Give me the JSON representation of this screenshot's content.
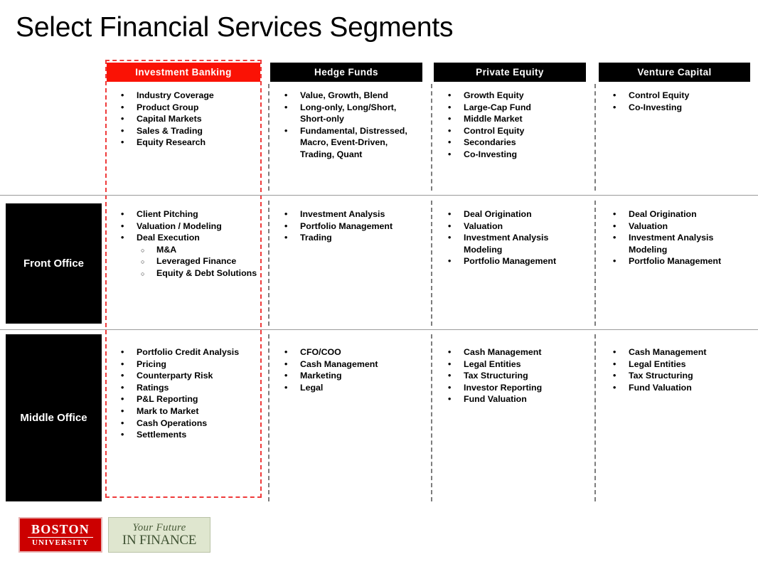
{
  "slide": {
    "title": "Select Financial Services Segments",
    "accent_color": "#fa1205",
    "header_color": "#000000",
    "highlight_border_color": "#ef3b3b",
    "divider_color": "#7d7d7d"
  },
  "columns": [
    {
      "id": "investment-banking",
      "label": "Investment  Banking",
      "highlighted": true
    },
    {
      "id": "hedge-funds",
      "label": "Hedge  Funds",
      "highlighted": false
    },
    {
      "id": "private-equity",
      "label": "Private Equity",
      "highlighted": false
    },
    {
      "id": "venture-capital",
      "label": "Venture  Capital",
      "highlighted": false
    }
  ],
  "rows": [
    {
      "id": "segment-types",
      "label": ""
    },
    {
      "id": "front-office",
      "label": "Front Office"
    },
    {
      "id": "middle-office",
      "label": "Middle Office"
    }
  ],
  "cells": {
    "segment_types": {
      "investment_banking": [
        {
          "text": "Industry Coverage"
        },
        {
          "text": "Product Group"
        },
        {
          "text": "Capital Markets"
        },
        {
          "text": "Sales & Trading"
        },
        {
          "text": "Equity Research"
        }
      ],
      "hedge_funds": [
        {
          "text": "Value, Growth, Blend"
        },
        {
          "text": "Long-only, Long/Short, Short-only"
        },
        {
          "text": "Fundamental, Distressed, Macro, Event-Driven, Trading, Quant"
        }
      ],
      "private_equity": [
        {
          "text": "Growth Equity"
        },
        {
          "text": "Large-Cap Fund"
        },
        {
          "text": "Middle Market"
        },
        {
          "text": "Control Equity"
        },
        {
          "text": "Secondaries"
        },
        {
          "text": "Co-Investing"
        }
      ],
      "venture_capital": [
        {
          "text": "Control Equity"
        },
        {
          "text": "Co-Investing"
        }
      ]
    },
    "front_office": {
      "investment_banking": [
        {
          "text": "Client Pitching"
        },
        {
          "text": "Valuation / Modeling"
        },
        {
          "text": "Deal Execution"
        },
        {
          "text": "M&A",
          "sub": true
        },
        {
          "text": "Leveraged Finance",
          "sub": true
        },
        {
          "text": "Equity & Debt Solutions",
          "sub": true
        }
      ],
      "hedge_funds": [
        {
          "text": "Investment Analysis"
        },
        {
          "text": "Portfolio Management"
        },
        {
          "text": "Trading"
        }
      ],
      "private_equity": [
        {
          "text": "Deal Origination"
        },
        {
          "text": "Valuation"
        },
        {
          "text": "Investment Analysis Modeling"
        },
        {
          "text": "Portfolio Management"
        }
      ],
      "venture_capital": [
        {
          "text": "Deal Origination"
        },
        {
          "text": "Valuation"
        },
        {
          "text": "Investment Analysis Modeling"
        },
        {
          "text": "Portfolio Management"
        }
      ]
    },
    "middle_office": {
      "investment_banking": [
        {
          "text": "Portfolio Credit Analysis"
        },
        {
          "text": "Pricing"
        },
        {
          "text": "Counterparty Risk"
        },
        {
          "text": "Ratings"
        },
        {
          "text": "P&L Reporting"
        },
        {
          "text": "Mark to Market"
        },
        {
          "text": "Cash Operations"
        },
        {
          "text": "Settlements"
        }
      ],
      "hedge_funds": [
        {
          "text": "CFO/COO"
        },
        {
          "text": "Cash Management"
        },
        {
          "text": "Marketing"
        },
        {
          "text": "Legal"
        }
      ],
      "private_equity": [
        {
          "text": "Cash Management"
        },
        {
          "text": "Legal Entities"
        },
        {
          "text": "Tax Structuring"
        },
        {
          "text": "Investor Reporting"
        },
        {
          "text": "Fund Valuation"
        }
      ],
      "venture_capital": [
        {
          "text": "Cash Management"
        },
        {
          "text": "Legal Entities"
        },
        {
          "text": "Tax Structuring"
        },
        {
          "text": "Fund Valuation"
        }
      ]
    }
  },
  "footer": {
    "bu_logo": {
      "line1": "BOSTON",
      "line2": "UNIVERSITY",
      "color": "#cc0000"
    },
    "yf_logo": {
      "line1": "Your Future",
      "line2": "IN FINANCE",
      "color": "#dfe6cf"
    }
  },
  "bullets": {
    "level1": "•",
    "level2": "○"
  }
}
